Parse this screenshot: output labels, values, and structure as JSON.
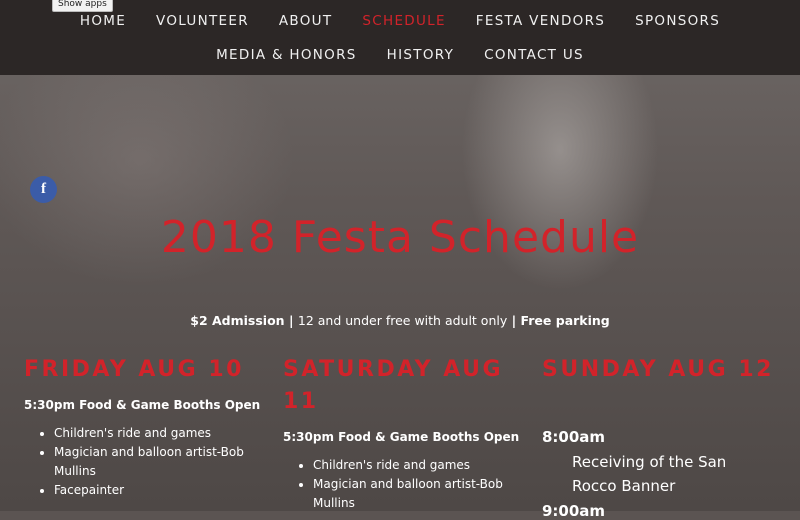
{
  "show_apps": "Show apps",
  "nav": {
    "row1": [
      "HOME",
      "VOLUNTEER",
      "ABOUT",
      "SCHEDULE",
      "FESTA VENDORS",
      "SPONSORS"
    ],
    "row2": [
      "MEDIA & HONORS",
      "HISTORY",
      "CONTACT US"
    ],
    "active": "SCHEDULE"
  },
  "social": {
    "icon": "facebook-icon",
    "glyph": "f"
  },
  "title": "2018 Festa Schedule",
  "admission": {
    "part1": "$2 Admission",
    "sep1": " | ",
    "part2": "12 and under free with adult only",
    "sep2": " | ",
    "part3": "Free parking"
  },
  "days": [
    {
      "heading": "FRIDAY  AUG 10",
      "subheading": "5:30pm Food & Game Booths Open",
      "items": [
        "Children's ride and games",
        "Magician and balloon artist-Bob Mullins",
        "Facepainter"
      ]
    },
    {
      "heading": "SATURDAY AUG 11",
      "subheading": "5:30pm Food & Game Booths Open",
      "items": [
        "Children's ride and games",
        "Magician and balloon artist-Bob Mullins"
      ]
    },
    {
      "heading": "SUNDAY AUG 12",
      "time": "8:00am",
      "event": "Receiving of the San Rocco Banner",
      "time2": "9:00am"
    }
  ],
  "colors": {
    "accent": "#d2232a",
    "nav_bg": "#2c2726",
    "facebook": "#3b5ca8"
  }
}
